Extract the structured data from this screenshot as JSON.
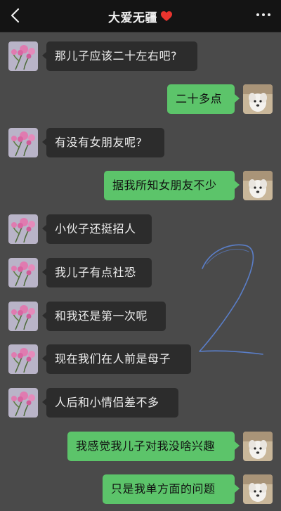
{
  "header": {
    "title": "大爱无疆",
    "back_icon": "back-chevron-icon",
    "title_icon": "red-heart-icon",
    "more_icon": "more-dots-icon",
    "heart_color": "#e8342e"
  },
  "colors": {
    "chat_background": "#4a4a4a",
    "incoming_bubble": "#2c2c2c",
    "outgoing_bubble": "#5cc46a",
    "doodle_stroke": "#5a7ec8"
  },
  "avatars": {
    "contact": "pink-flower-avatar",
    "self": "white-dog-avatar"
  },
  "messages": [
    {
      "side": "in",
      "text": "那儿子应该二十左右吧?"
    },
    {
      "side": "out",
      "text": "二十多点"
    },
    {
      "side": "in",
      "text": "有没有女朋友呢?"
    },
    {
      "side": "out",
      "text": "据我所知女朋友不少"
    },
    {
      "side": "in",
      "text": "小伙子还挺招人"
    },
    {
      "side": "in",
      "text": "我儿子有点社恐"
    },
    {
      "side": "in",
      "text": "和我还是第一次呢"
    },
    {
      "side": "in",
      "text": "现在我们在人前是母子"
    },
    {
      "side": "in",
      "text": "人后和小情侣差不多"
    },
    {
      "side": "out",
      "text": "我感觉我儿子对我没啥兴趣"
    },
    {
      "side": "out",
      "text": "只是我单方面的问题"
    }
  ]
}
